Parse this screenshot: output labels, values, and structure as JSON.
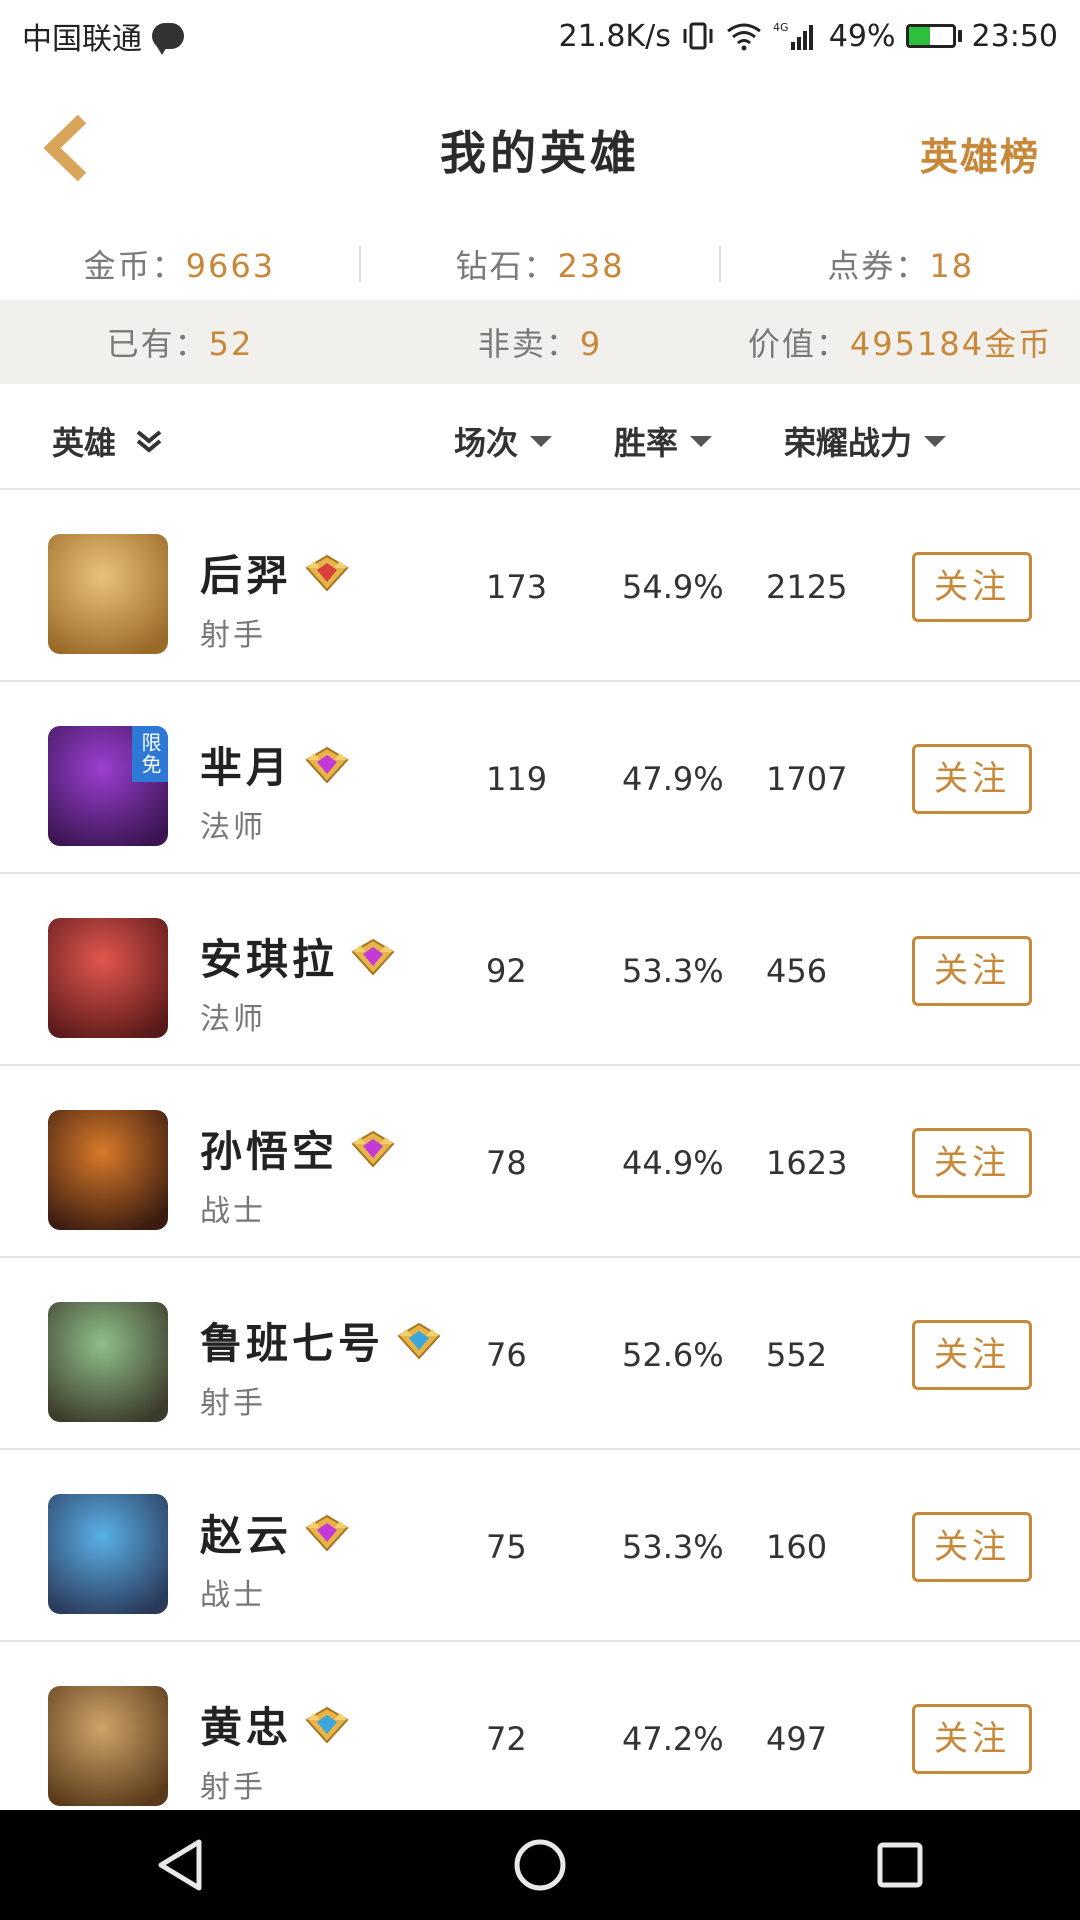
{
  "status": {
    "carrier": "中国联通",
    "speed": "21.8K/s",
    "network": "4G",
    "battery": "49%",
    "battery_level": 0.49,
    "time": "23:50"
  },
  "nav": {
    "title": "我的英雄",
    "right_link": "英雄榜"
  },
  "currency": {
    "gold_label": "金币：",
    "gold_value": "9663",
    "diamond_label": "钻石：",
    "diamond_value": "238",
    "voucher_label": "点券：",
    "voucher_value": "18"
  },
  "summary": {
    "owned_label": "已有：",
    "owned_value": "52",
    "notsold_label": "非卖：",
    "notsold_value": "9",
    "worth_label": "价值：",
    "worth_value": "495184金币"
  },
  "headers": {
    "hero": "英雄",
    "matches": "场次",
    "winrate": "胜率",
    "power": "荣耀战力"
  },
  "follow_label": "关注",
  "free_tag": "限免",
  "heroes": [
    {
      "name": "后羿",
      "role": "射手",
      "matches": "173",
      "winrate": "54.9%",
      "power": "2125",
      "badge": "gold-red"
    },
    {
      "name": "芈月",
      "role": "法师",
      "matches": "119",
      "winrate": "47.9%",
      "power": "1707",
      "badge": "gold-purple"
    },
    {
      "name": "安琪拉",
      "role": "法师",
      "matches": "92",
      "winrate": "53.3%",
      "power": "456",
      "badge": "gold-purple"
    },
    {
      "name": "孙悟空",
      "role": "战士",
      "matches": "78",
      "winrate": "44.9%",
      "power": "1623",
      "badge": "gold-purple"
    },
    {
      "name": "鲁班七号",
      "role": "射手",
      "matches": "76",
      "winrate": "52.6%",
      "power": "552",
      "badge": "gold-blue"
    },
    {
      "name": "赵云",
      "role": "战士",
      "matches": "75",
      "winrate": "53.3%",
      "power": "160",
      "badge": "gold-purple"
    },
    {
      "name": "黄忠",
      "role": "射手",
      "matches": "72",
      "winrate": "47.2%",
      "power": "497",
      "badge": "gold-blue"
    }
  ],
  "colors": {
    "accent": "#c8883a",
    "summary_bg": "#f1f0ec"
  }
}
